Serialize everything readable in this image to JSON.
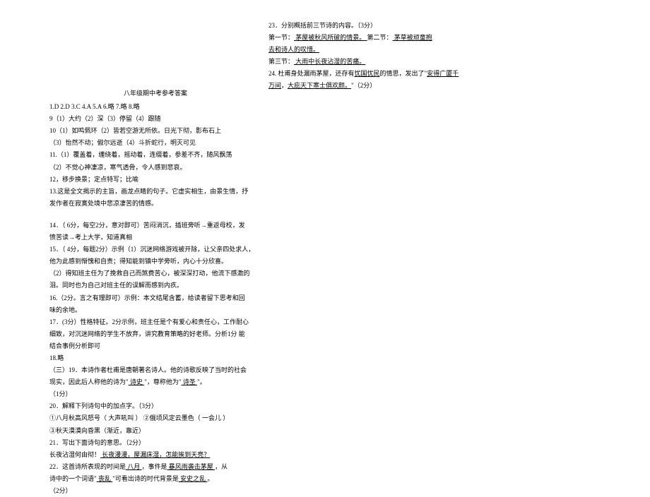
{
  "left": {
    "title": "八年级期中考参考答案",
    "l1": "1.D   2.D   3.C   4.A   5.A   6.略 7.略 8.略",
    "l2": "9（1）大约（2）深（3）停留（4）跟随",
    "l3": "10（1）如鸣佩环（2）皆若空游无所依。日光下彻，影布石上",
    "l4": "（3）怡然不动；俶尔远逝（4）斗折蛇行，明灭可见",
    "l5": "11.（1）覆盖着，缠绕着，摇动着，连缀着，参差不齐，随风飘荡",
    "l6": "（2）不觉心神凄凉，寒气透骨，令人感到悲哀。",
    "l7": "12，移步换景；定点特写；比喻",
    "l8": "13.这是全文揭示的主旨，画龙点睛的句子。它虚实相生，由景生情，抒",
    "l9": "发作者在寂寞处境中悲凉凄苦的情感。",
    "l14a": "14．（ 6分，每空2分，意对即可）苦闷消沉，插班旁听→重返母校，发",
    "l14b": "愤苦读→考上大学，知道真相",
    "l15a": "15．（ 4分，每题2分）示例（1）沉迷网络游戏被开除，让父亲四处求人，",
    "l15b": "他为此感到惭愧和自责；得知能到镇中学旁听，内心十分欣喜。",
    "l15c": "（2）得知班主任为了挽救自己而煞费苦心，被深深打动，他流下感激的",
    "l15d": "泪。同时也为自己对班主任的误解而感到内疚。",
    "l16a": "16.（2分。言之有理即可）示例：本文结尾含蓄，给读者留下思考和回",
    "l16b": "味的余地。",
    "l17a": "17．(3分）性格特征。2分示例，班主任是个有爱心和责任心，工作耐心",
    "l17b": "细致，对沉迷网络的学生不放弃，讲究教育策略的好老师。分析1分   能",
    "l17c": "结合事例分析即可",
    "l18": "18.略",
    "l19a": "（三）19．本诗作者杜甫是唐朝著名诗人。他的诗歌反映了当时的社会",
    "l19b_a": "现实，因此后人称他的诗为\"",
    "l19b_u1": "   诗史   ",
    "l19b_b": "\"，尊称他为\"",
    "l19b_u2": "   诗圣   ",
    "l19b_c": "\"。",
    "l19c": "（1分）",
    "l20": "20．解释下列诗句中的加点字。（3分）",
    "l20a": "①八月秋高风怒号（ 大声吼叫 ）   ②俄顷风定云墨色（ 一会儿 ）",
    "l20b": "③秋天漠漠向昏黑（渐近，靠近）",
    "l21": "21．写出下面诗句的意思。（2分）",
    "l21a_a": "              长夜沾湿何由彻！",
    "l21a_u": "   长夜漫漫，屋漏床湿，怎能挨到天亮？   ",
    "l22_a": "22．这首诗所表现的时间是",
    "l22_u1": "   八月   ",
    "l22_b": "，事件是",
    "l22_u2": "   暴风雨袭击茅屋   ",
    "l22_c": "，从",
    "l22d_a": "诗中的一个词语\"",
    "l22d_u1": "   丧乱   ",
    "l22d_b": "\"可看出诗的时代背景是",
    "l22d_u2": " 安史之乱       ",
    "l22d_c": "。",
    "l22e": "（2分）"
  },
  "right": {
    "r23": "23．分别概括前三节诗的内容。（3分）",
    "r23a_a": "第一节：",
    "r23a_u": "   茅屋被秋风所破的情景。         ",
    "r23a_b": "第二节：",
    "r23a_u2": "   茅草被顽童抱",
    "r23b_u": "去和诗人的叹惜。             ",
    "r23c_a": "第三节：",
    "r23c_u": "   大雨中长夜沾湿的苦痛。           ",
    "r24_a": "24. 杜甫身处漏雨茅屋，还存有",
    "r24_u1": "忧国忧民",
    "r24_b": "的情思，发出了\"",
    "r24_u2": "安得广厦千",
    "r24c_u": "万间",
    "r24c_a": "，",
    "r24c_u2": "大庇天下寒士俱欢颜。",
    "r24c_b": "\"（2分）"
  }
}
